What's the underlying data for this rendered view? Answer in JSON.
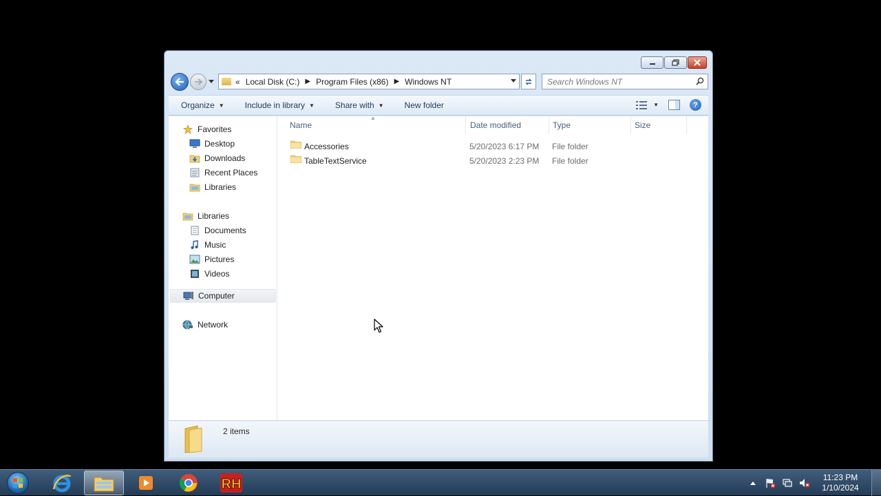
{
  "window": {
    "caption_buttons": {
      "minimize_icon": "minimize-icon",
      "maximize_icon": "maximize-icon",
      "close_icon": "close-icon"
    }
  },
  "navigation": {
    "back_icon": "back-arrow-icon",
    "forward_icon": "forward-arrow-icon"
  },
  "address_bar": {
    "overflow": "«",
    "crumbs": [
      "Local Disk (C:)",
      "Program Files (x86)",
      "Windows NT"
    ]
  },
  "search": {
    "placeholder": "Search Windows NT"
  },
  "command_bar": {
    "organize": "Organize",
    "include_in_library": "Include in library",
    "share_with": "Share with",
    "new_folder": "New folder"
  },
  "nav_pane": {
    "favorites": {
      "label": "Favorites",
      "items": [
        "Desktop",
        "Downloads",
        "Recent Places",
        "Libraries"
      ]
    },
    "libraries": {
      "label": "Libraries",
      "items": [
        "Documents",
        "Music",
        "Pictures",
        "Videos"
      ]
    },
    "computer": "Computer",
    "network": "Network"
  },
  "columns": {
    "name": "Name",
    "date_modified": "Date modified",
    "type": "Type",
    "size": "Size"
  },
  "files": [
    {
      "name": "Accessories",
      "date_modified": "5/20/2023 6:17 PM",
      "type": "File folder",
      "size": ""
    },
    {
      "name": "TableTextService",
      "date_modified": "5/20/2023 2:23 PM",
      "type": "File folder",
      "size": ""
    }
  ],
  "details": {
    "item_count": "2 items"
  },
  "taskbar": {
    "apps": [
      "start-orb-icon",
      "internet-explorer-icon",
      "file-explorer-icon",
      "media-player-icon",
      "chrome-icon",
      "rh-app-icon"
    ],
    "clock": {
      "time": "11:23 PM",
      "date": "1/10/2024"
    }
  },
  "colors": {
    "taskbar": "#2f4a66",
    "window_frame": "#d6e4f3",
    "link_text": "#1e395b"
  }
}
